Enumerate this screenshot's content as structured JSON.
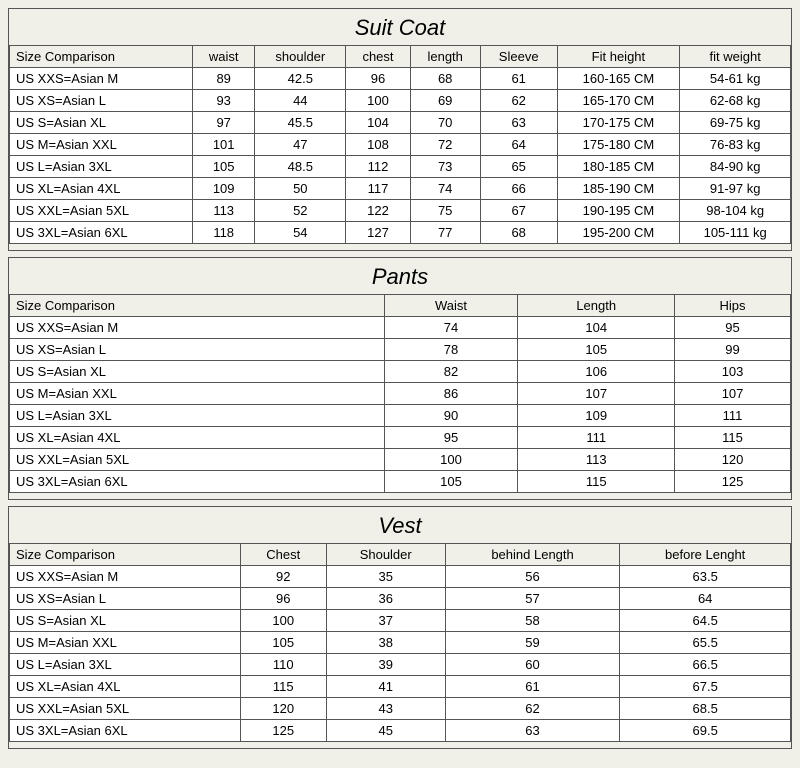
{
  "suitCoat": {
    "title": "Suit Coat",
    "headers": [
      "Size Comparison",
      "waist",
      "shoulder",
      "chest",
      "length",
      "Sleeve",
      "Fit height",
      "fit weight"
    ],
    "rows": [
      [
        "US XXS=Asian M",
        "89",
        "42.5",
        "96",
        "68",
        "61",
        "160-165 CM",
        "54-61 kg"
      ],
      [
        "US XS=Asian L",
        "93",
        "44",
        "100",
        "69",
        "62",
        "165-170 CM",
        "62-68 kg"
      ],
      [
        "US S=Asian XL",
        "97",
        "45.5",
        "104",
        "70",
        "63",
        "170-175 CM",
        "69-75 kg"
      ],
      [
        "US M=Asian XXL",
        "101",
        "47",
        "108",
        "72",
        "64",
        "175-180 CM",
        "76-83 kg"
      ],
      [
        "US L=Asian 3XL",
        "105",
        "48.5",
        "112",
        "73",
        "65",
        "180-185 CM",
        "84-90 kg"
      ],
      [
        "US XL=Asian 4XL",
        "109",
        "50",
        "117",
        "74",
        "66",
        "185-190 CM",
        "91-97 kg"
      ],
      [
        "US XXL=Asian 5XL",
        "113",
        "52",
        "122",
        "75",
        "67",
        "190-195 CM",
        "98-104 kg"
      ],
      [
        "US 3XL=Asian 6XL",
        "118",
        "54",
        "127",
        "77",
        "68",
        "195-200 CM",
        "105-111 kg"
      ]
    ]
  },
  "pants": {
    "title": "Pants",
    "headers": [
      "Size Comparison",
      "Waist",
      "Length",
      "Hips"
    ],
    "rows": [
      [
        "US XXS=Asian M",
        "74",
        "104",
        "95"
      ],
      [
        "US XS=Asian L",
        "78",
        "105",
        "99"
      ],
      [
        "US S=Asian XL",
        "82",
        "106",
        "103"
      ],
      [
        "US M=Asian XXL",
        "86",
        "107",
        "107"
      ],
      [
        "US L=Asian 3XL",
        "90",
        "109",
        "111"
      ],
      [
        "US XL=Asian 4XL",
        "95",
        "111",
        "115"
      ],
      [
        "US XXL=Asian 5XL",
        "100",
        "113",
        "120"
      ],
      [
        "US 3XL=Asian 6XL",
        "105",
        "115",
        "125"
      ]
    ]
  },
  "vest": {
    "title": "Vest",
    "headers": [
      "Size Comparison",
      "Chest",
      "Shoulder",
      "behind Length",
      "before Lenght"
    ],
    "rows": [
      [
        "US XXS=Asian M",
        "92",
        "35",
        "56",
        "63.5"
      ],
      [
        "US XS=Asian L",
        "96",
        "36",
        "57",
        "64"
      ],
      [
        "US S=Asian XL",
        "100",
        "37",
        "58",
        "64.5"
      ],
      [
        "US M=Asian XXL",
        "105",
        "38",
        "59",
        "65.5"
      ],
      [
        "US L=Asian 3XL",
        "110",
        "39",
        "60",
        "66.5"
      ],
      [
        "US XL=Asian 4XL",
        "115",
        "41",
        "61",
        "67.5"
      ],
      [
        "US XXL=Asian 5XL",
        "120",
        "43",
        "62",
        "68.5"
      ],
      [
        "US 3XL=Asian 6XL",
        "125",
        "45",
        "63",
        "69.5"
      ]
    ]
  }
}
